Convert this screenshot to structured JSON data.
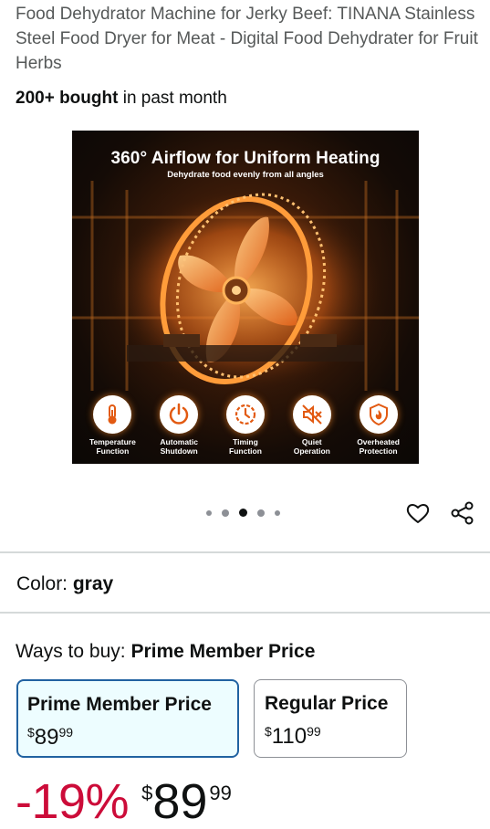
{
  "product": {
    "title": "Food Dehydrator Machine for Jerky Beef: TINANA Stainless Steel Food Dryer for Meat - Digital Food Dehydrater for Fruit Herbs",
    "bought_bold": "200+ bought",
    "bought_rest": " in past month"
  },
  "hero": {
    "headline": "360° Airflow for Uniform Heating",
    "subheadline": "Dehydrate food evenly from all angles",
    "features": [
      {
        "label": "Temperature\nFunction",
        "icon": "thermometer-icon"
      },
      {
        "label": "Automatic\nShutdown",
        "icon": "power-icon"
      },
      {
        "label": "Timing\nFunction",
        "icon": "timer-icon"
      },
      {
        "label": "Quiet\nOperation",
        "icon": "mute-icon"
      },
      {
        "label": "Overheated\nProtection",
        "icon": "flame-shield-icon"
      }
    ]
  },
  "carousel": {
    "total": 5,
    "active_index": 2
  },
  "color": {
    "label": "Color: ",
    "value": "gray"
  },
  "ways_to_buy": {
    "label": "Ways to buy: ",
    "value": "Prime Member Price"
  },
  "options": [
    {
      "label": "Prime Member Price",
      "symbol": "$",
      "whole": "89",
      "fraction": "99",
      "selected": true
    },
    {
      "label": "Regular Price",
      "symbol": "$",
      "whole": "110",
      "fraction": "99",
      "selected": false
    }
  ],
  "price": {
    "discount": "-19%",
    "symbol": "$",
    "whole": "89",
    "fraction": "99"
  },
  "colors": {
    "accent_border": "#2162a1",
    "selected_bg": "#edfdff",
    "discount": "#cc0c39",
    "glow": "#ff8c28"
  }
}
